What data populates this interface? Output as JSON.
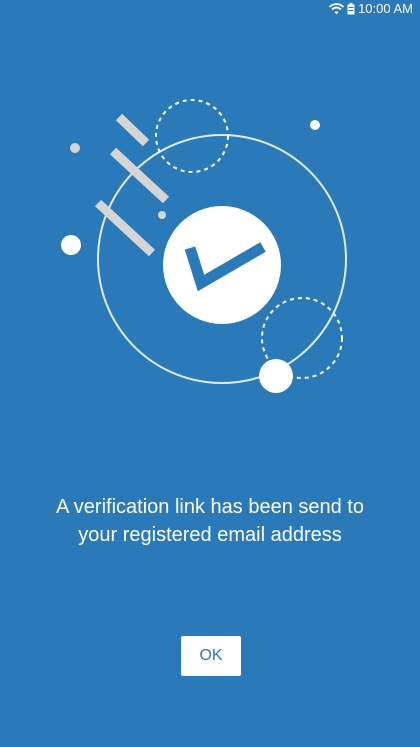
{
  "status_bar": {
    "time": "10:00 AM",
    "icons": [
      "wifi-icon",
      "battery-icon"
    ]
  },
  "illustration": {
    "icon": "check-icon"
  },
  "message": {
    "line1": "A verification link has been send to",
    "line2": "your registered email address"
  },
  "actions": {
    "ok_label": "OK"
  },
  "colors": {
    "background": "#2a79b9",
    "foreground": "#ffffff",
    "accent_gray": "#d5d5d5"
  }
}
